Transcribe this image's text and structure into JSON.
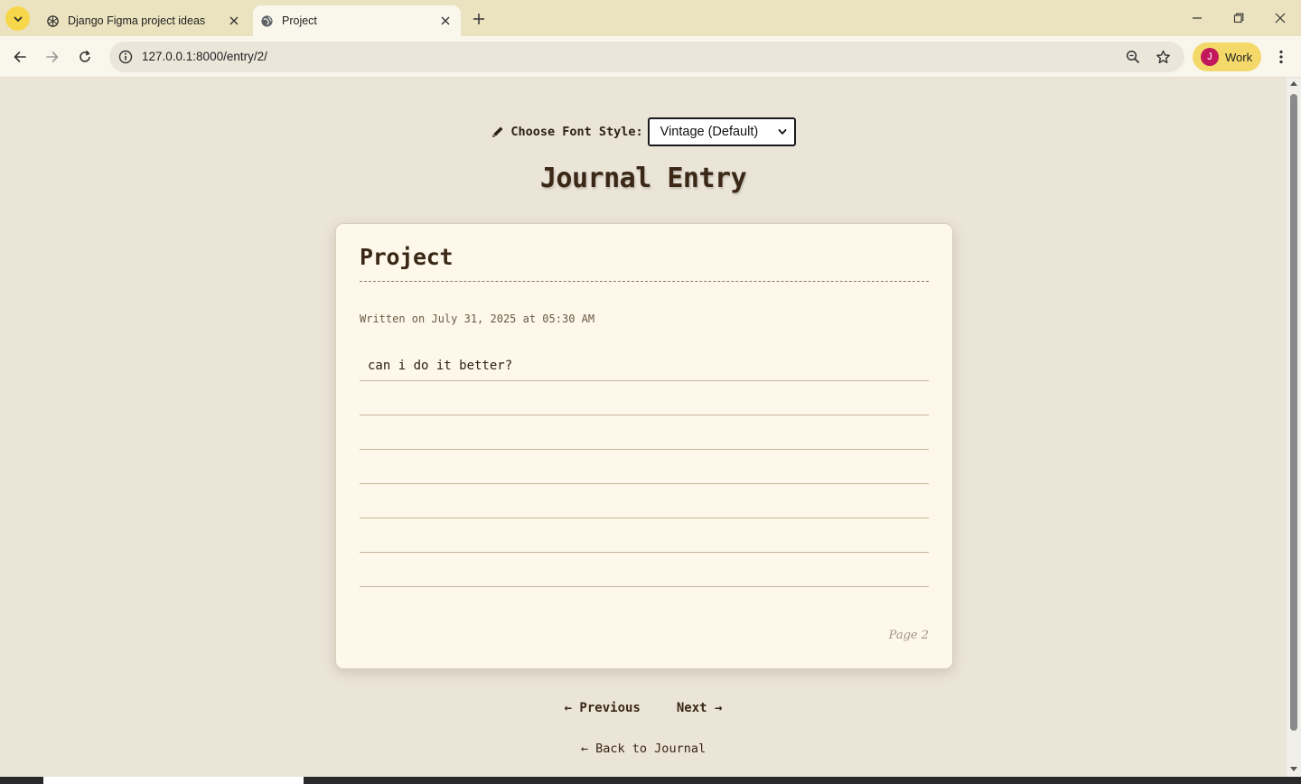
{
  "browser": {
    "tabs": [
      {
        "title": "Django Figma project ideas",
        "icon": "openai-icon",
        "active": false
      },
      {
        "title": "Project",
        "icon": "globe-icon",
        "active": true
      }
    ],
    "url": "127.0.0.1:8000/entry/2/",
    "profile": {
      "initial": "J",
      "label": "Work"
    }
  },
  "page": {
    "font_chooser": {
      "label": "Choose Font Style:",
      "selected": "Vintage (Default)"
    },
    "heading": "Journal Entry",
    "entry": {
      "title": "Project",
      "date": "Written on July 31, 2025 at 05:30 AM",
      "lines": [
        "can i do it better?",
        "",
        "",
        "",
        "",
        "",
        ""
      ],
      "page_label": "Page 2"
    },
    "nav": {
      "previous": "← Previous",
      "next": "Next →",
      "back": "← Back to Journal"
    }
  },
  "colors": {
    "tab_bar": "#ebe3bf",
    "page_bg": "#ebe5d8",
    "card_bg": "#fdf8ea",
    "ink": "#3a2716",
    "profile_chip": "#f4d96a",
    "avatar": "#c2185b"
  }
}
